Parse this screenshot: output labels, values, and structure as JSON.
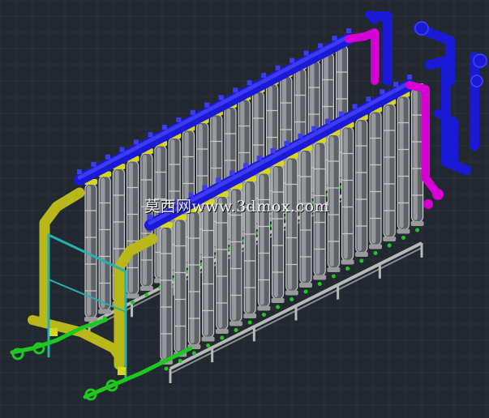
{
  "viewport": {
    "background": "#212830",
    "grid_color": "#2a323b",
    "watermark": "莫西网www.3dmox.com"
  },
  "model": {
    "subject": "uf-membrane-skid-isometric",
    "layer_colors": {
      "feed_header": "#1a1ad6",
      "feed_header_light": "#3c3cf5",
      "concentrate_pipe": "#d400d4",
      "membrane_module": "#c7c7c7",
      "module_dark": "#5d6168",
      "coupling": "#d6d61e",
      "frame": "#b9b9b9",
      "inlet_pipe": "#b8b81a",
      "support_pipe": "#26b0b0",
      "valve_line": "#1ec81e"
    }
  }
}
